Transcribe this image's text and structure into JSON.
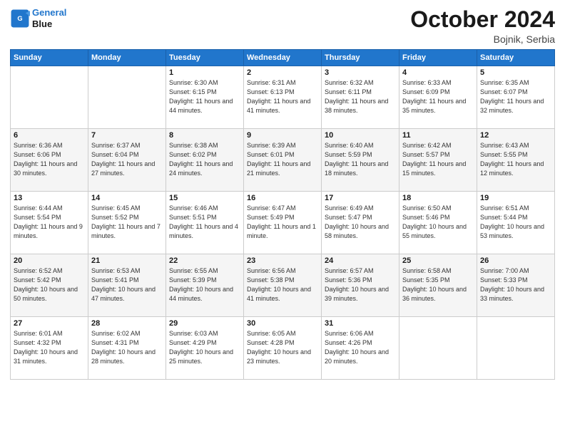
{
  "header": {
    "logo_line1": "General",
    "logo_line2": "Blue",
    "month_title": "October 2024",
    "location": "Bojnik, Serbia"
  },
  "weekdays": [
    "Sunday",
    "Monday",
    "Tuesday",
    "Wednesday",
    "Thursday",
    "Friday",
    "Saturday"
  ],
  "weeks": [
    [
      {
        "day": "",
        "info": ""
      },
      {
        "day": "",
        "info": ""
      },
      {
        "day": "1",
        "info": "Sunrise: 6:30 AM\nSunset: 6:15 PM\nDaylight: 11 hours and 44 minutes."
      },
      {
        "day": "2",
        "info": "Sunrise: 6:31 AM\nSunset: 6:13 PM\nDaylight: 11 hours and 41 minutes."
      },
      {
        "day": "3",
        "info": "Sunrise: 6:32 AM\nSunset: 6:11 PM\nDaylight: 11 hours and 38 minutes."
      },
      {
        "day": "4",
        "info": "Sunrise: 6:33 AM\nSunset: 6:09 PM\nDaylight: 11 hours and 35 minutes."
      },
      {
        "day": "5",
        "info": "Sunrise: 6:35 AM\nSunset: 6:07 PM\nDaylight: 11 hours and 32 minutes."
      }
    ],
    [
      {
        "day": "6",
        "info": "Sunrise: 6:36 AM\nSunset: 6:06 PM\nDaylight: 11 hours and 30 minutes."
      },
      {
        "day": "7",
        "info": "Sunrise: 6:37 AM\nSunset: 6:04 PM\nDaylight: 11 hours and 27 minutes."
      },
      {
        "day": "8",
        "info": "Sunrise: 6:38 AM\nSunset: 6:02 PM\nDaylight: 11 hours and 24 minutes."
      },
      {
        "day": "9",
        "info": "Sunrise: 6:39 AM\nSunset: 6:01 PM\nDaylight: 11 hours and 21 minutes."
      },
      {
        "day": "10",
        "info": "Sunrise: 6:40 AM\nSunset: 5:59 PM\nDaylight: 11 hours and 18 minutes."
      },
      {
        "day": "11",
        "info": "Sunrise: 6:42 AM\nSunset: 5:57 PM\nDaylight: 11 hours and 15 minutes."
      },
      {
        "day": "12",
        "info": "Sunrise: 6:43 AM\nSunset: 5:55 PM\nDaylight: 11 hours and 12 minutes."
      }
    ],
    [
      {
        "day": "13",
        "info": "Sunrise: 6:44 AM\nSunset: 5:54 PM\nDaylight: 11 hours and 9 minutes."
      },
      {
        "day": "14",
        "info": "Sunrise: 6:45 AM\nSunset: 5:52 PM\nDaylight: 11 hours and 7 minutes."
      },
      {
        "day": "15",
        "info": "Sunrise: 6:46 AM\nSunset: 5:51 PM\nDaylight: 11 hours and 4 minutes."
      },
      {
        "day": "16",
        "info": "Sunrise: 6:47 AM\nSunset: 5:49 PM\nDaylight: 11 hours and 1 minute."
      },
      {
        "day": "17",
        "info": "Sunrise: 6:49 AM\nSunset: 5:47 PM\nDaylight: 10 hours and 58 minutes."
      },
      {
        "day": "18",
        "info": "Sunrise: 6:50 AM\nSunset: 5:46 PM\nDaylight: 10 hours and 55 minutes."
      },
      {
        "day": "19",
        "info": "Sunrise: 6:51 AM\nSunset: 5:44 PM\nDaylight: 10 hours and 53 minutes."
      }
    ],
    [
      {
        "day": "20",
        "info": "Sunrise: 6:52 AM\nSunset: 5:42 PM\nDaylight: 10 hours and 50 minutes."
      },
      {
        "day": "21",
        "info": "Sunrise: 6:53 AM\nSunset: 5:41 PM\nDaylight: 10 hours and 47 minutes."
      },
      {
        "day": "22",
        "info": "Sunrise: 6:55 AM\nSunset: 5:39 PM\nDaylight: 10 hours and 44 minutes."
      },
      {
        "day": "23",
        "info": "Sunrise: 6:56 AM\nSunset: 5:38 PM\nDaylight: 10 hours and 41 minutes."
      },
      {
        "day": "24",
        "info": "Sunrise: 6:57 AM\nSunset: 5:36 PM\nDaylight: 10 hours and 39 minutes."
      },
      {
        "day": "25",
        "info": "Sunrise: 6:58 AM\nSunset: 5:35 PM\nDaylight: 10 hours and 36 minutes."
      },
      {
        "day": "26",
        "info": "Sunrise: 7:00 AM\nSunset: 5:33 PM\nDaylight: 10 hours and 33 minutes."
      }
    ],
    [
      {
        "day": "27",
        "info": "Sunrise: 6:01 AM\nSunset: 4:32 PM\nDaylight: 10 hours and 31 minutes."
      },
      {
        "day": "28",
        "info": "Sunrise: 6:02 AM\nSunset: 4:31 PM\nDaylight: 10 hours and 28 minutes."
      },
      {
        "day": "29",
        "info": "Sunrise: 6:03 AM\nSunset: 4:29 PM\nDaylight: 10 hours and 25 minutes."
      },
      {
        "day": "30",
        "info": "Sunrise: 6:05 AM\nSunset: 4:28 PM\nDaylight: 10 hours and 23 minutes."
      },
      {
        "day": "31",
        "info": "Sunrise: 6:06 AM\nSunset: 4:26 PM\nDaylight: 10 hours and 20 minutes."
      },
      {
        "day": "",
        "info": ""
      },
      {
        "day": "",
        "info": ""
      }
    ]
  ]
}
